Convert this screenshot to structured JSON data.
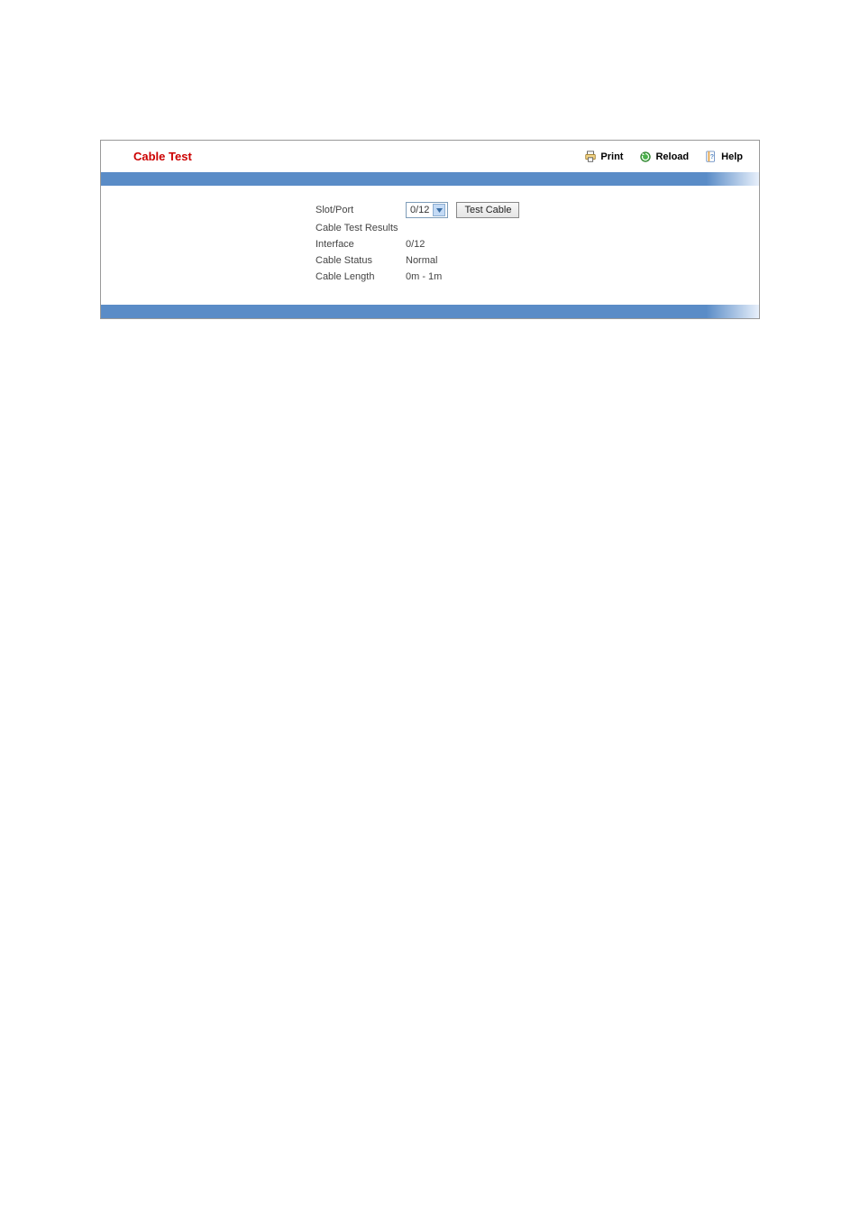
{
  "header": {
    "title": "Cable Test",
    "toolbar": {
      "print": "Print",
      "reload": "Reload",
      "help": "Help"
    }
  },
  "form": {
    "slot_port_label": "Slot/Port",
    "slot_port_value": "0/12",
    "test_button": "Test Cable"
  },
  "results": {
    "section_label": "Cable Test Results",
    "interface_label": "Interface",
    "interface_value": "0/12",
    "status_label": "Cable Status",
    "status_value": "Normal",
    "length_label": "Cable Length",
    "length_value": "0m - 1m"
  }
}
